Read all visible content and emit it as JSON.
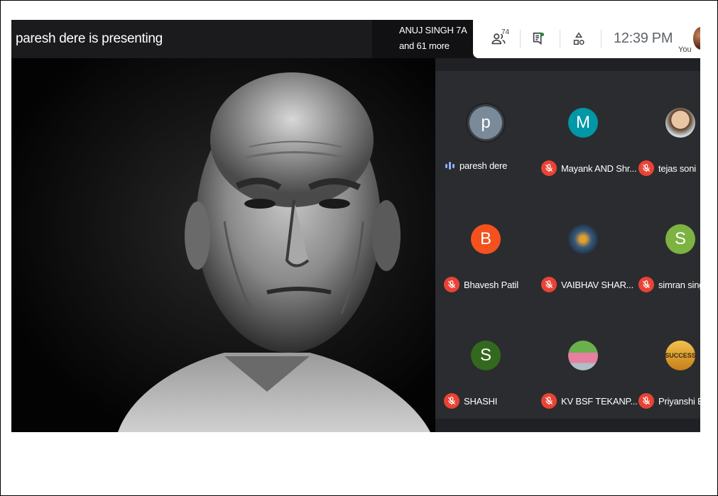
{
  "colors": {
    "accent_blue": "#8ab4f8",
    "muted_red": "#ea4335",
    "meet_bg": "#202124"
  },
  "header": {
    "presenting": "paresh dere is presenting",
    "raised_line1": "ANUJ SINGH 7A",
    "raised_line2": "and 61 more"
  },
  "controls": {
    "participants_count": "74",
    "people_icon": "people-icon",
    "chat_icon": "chat-icon",
    "activities_icon": "activities-icon",
    "time": "12:39 PM",
    "you_label": "You"
  },
  "participants": [
    {
      "name": "paresh dere",
      "initial": "p",
      "avatar_color": "#7a8a99",
      "status": "speaking"
    },
    {
      "name": "Mayank AND Shr...",
      "initial": "M",
      "avatar_color": "#0097a7",
      "status": "muted"
    },
    {
      "name": "tejas soni",
      "initial": "",
      "avatar_color": "#c9a27a",
      "status": "muted"
    },
    {
      "name": "Bhavesh Patil",
      "initial": "B",
      "avatar_color": "#f4511e",
      "status": "muted"
    },
    {
      "name": "VAIBHAV SHAR...",
      "initial": "",
      "avatar_color": "#2b3a4a",
      "status": "muted"
    },
    {
      "name": "simran singh",
      "initial": "S",
      "avatar_color": "#7cb342",
      "status": "muted"
    },
    {
      "name": "SHASHI",
      "initial": "S",
      "avatar_color": "#33691e",
      "status": "muted"
    },
    {
      "name": "KV BSF TEKANP...",
      "initial": "",
      "avatar_color": "#d17f9a",
      "status": "muted"
    },
    {
      "name": "Priyanshi Bh",
      "initial": "",
      "avatar_color": "#e6b23a",
      "status": "muted"
    }
  ],
  "avatar_image_text": "SUCCESS"
}
